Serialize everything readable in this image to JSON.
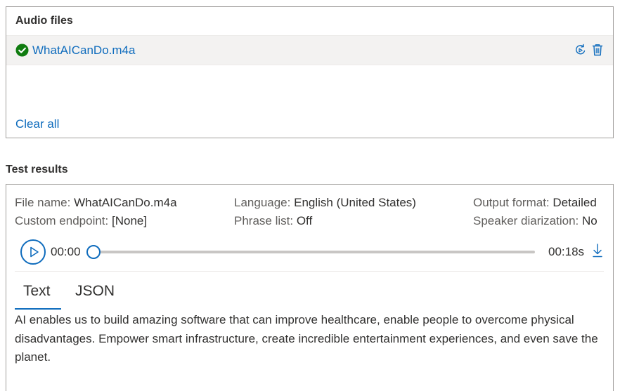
{
  "audio_files": {
    "title": "Audio files",
    "file": {
      "name": "WhatAICanDo.m4a",
      "status": "check-circle-icon"
    },
    "clear_all": "Clear all"
  },
  "test_results": {
    "title": "Test results",
    "meta": {
      "file_name_label": "File name:",
      "file_name_value": "WhatAICanDo.m4a",
      "custom_endpoint_label": "Custom endpoint:",
      "custom_endpoint_value": "[None]",
      "language_label": "Language:",
      "language_value": "English (United States)",
      "phrase_list_label": "Phrase list:",
      "phrase_list_value": "Off",
      "output_format_label": "Output format:",
      "output_format_value": "Detailed",
      "speaker_diarization_label": "Speaker diarization:",
      "speaker_diarization_value": "No"
    },
    "player": {
      "current_time": "00:00",
      "duration": "00:18s",
      "progress": 0
    },
    "tabs": [
      {
        "label": "Text",
        "selected": true
      },
      {
        "label": "JSON",
        "selected": false
      }
    ],
    "transcript": "AI enables us to build amazing software that can improve healthcare, enable people to overcome physical disadvantages. Empower smart infrastructure, create incredible entertainment experiences, and even save the planet."
  },
  "colors": {
    "accent": "#0f6cbd",
    "success": "#107c10",
    "row_background": "#f3f2f1",
    "border": "#a19f9d"
  }
}
